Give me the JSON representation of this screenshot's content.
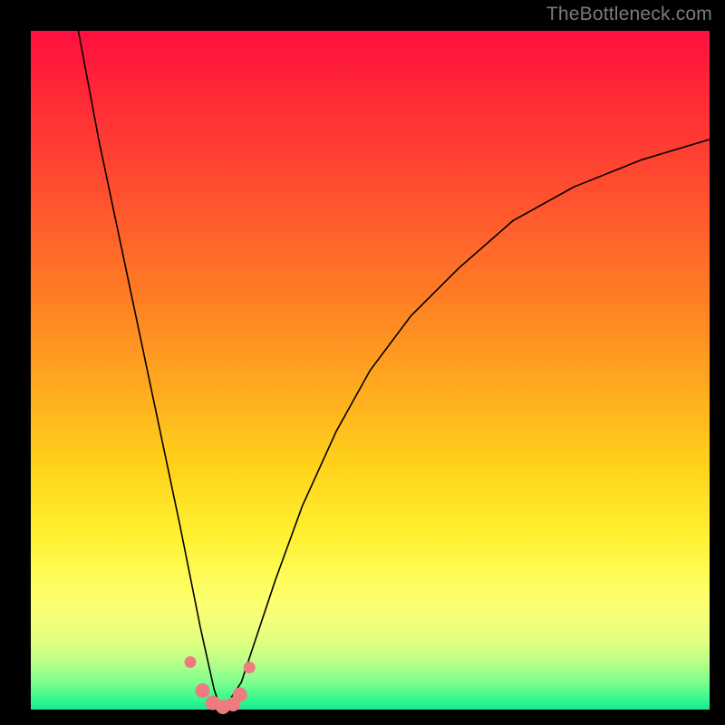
{
  "watermark": "TheBottleneck.com",
  "colors": {
    "frame": "#000000",
    "gradient_top": "#ff1040",
    "gradient_mid": "#ffd21a",
    "gradient_bottom": "#1de592",
    "curve": "#000000",
    "markers": "#ef7b7e"
  },
  "chart_data": {
    "type": "line",
    "title": "",
    "xlabel": "",
    "ylabel": "",
    "xlim": [
      0,
      100
    ],
    "ylim": [
      0,
      100
    ],
    "grid": false,
    "legend": false,
    "note": "V-shaped bottleneck curve; y ≈ bottleneck %, minimum near x ≈ 28. Axis values are unlabeled; estimates from gridless plot.",
    "series": [
      {
        "name": "bottleneck-curve",
        "x": [
          7,
          10,
          14,
          18,
          22,
          25,
          27,
          28,
          29,
          31,
          33,
          36,
          40,
          45,
          50,
          56,
          63,
          71,
          80,
          90,
          100
        ],
        "y": [
          100,
          84,
          65,
          46,
          27,
          12,
          3,
          0,
          1,
          4,
          10,
          19,
          30,
          41,
          50,
          58,
          65,
          72,
          77,
          81,
          84
        ]
      }
    ],
    "markers": {
      "name": "near-minimum-points",
      "x": [
        23.5,
        25.3,
        26.8,
        28.3,
        29.8,
        30.8,
        32.2
      ],
      "y": [
        7.0,
        2.8,
        1.0,
        0.4,
        0.8,
        2.2,
        6.2
      ]
    }
  }
}
